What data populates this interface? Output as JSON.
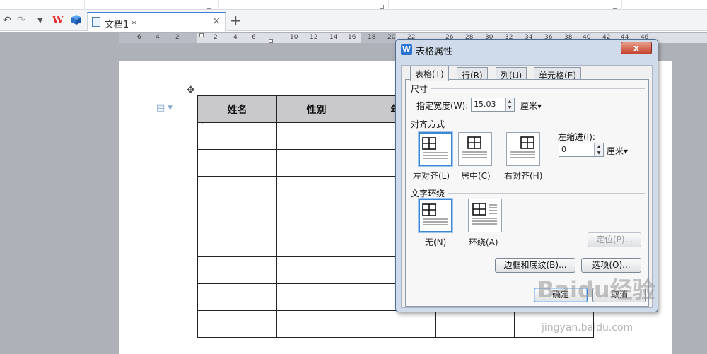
{
  "tabbar": {
    "doc_title": "文档1 *",
    "close_glyph": "×",
    "new_tab_glyph": "+",
    "wps_logo": "W"
  },
  "ruler": {
    "ticks": [
      "6",
      "4",
      "2",
      "2",
      "4",
      "6",
      "10",
      "12",
      "14",
      "16",
      "18",
      "20",
      "22",
      "26",
      "28",
      "30",
      "32",
      "34",
      "36",
      "38",
      "40",
      "42",
      "44",
      "46"
    ]
  },
  "document": {
    "table_headers": [
      "姓名",
      "性别",
      "年"
    ]
  },
  "dialog": {
    "title": "表格属性",
    "close_glyph": "x",
    "tabs": [
      "表格(T)",
      "行(R)",
      "列(U)",
      "单元格(E)"
    ],
    "size_section": "尺寸",
    "width_label": "指定宽度(W):",
    "width_value": "15.03",
    "width_unit": "厘米▾",
    "align_section": "对齐方式",
    "align_left": "左对齐(L)",
    "align_center": "居中(C)",
    "align_right": "右对齐(H)",
    "indent_label": "左缩进(I):",
    "indent_value": "0",
    "indent_unit": "厘米▾",
    "wrap_section": "文字环绕",
    "wrap_none": "无(N)",
    "wrap_around": "环绕(A)",
    "position_button": "定位(P)...",
    "borders_button": "边框和底纹(B)...",
    "options_button": "选项(O)...",
    "ok_button": "确定",
    "cancel_button": "取消"
  },
  "watermark": {
    "brand": "Baidu经验",
    "url": "jingyan.baidu.com"
  },
  "colors": {
    "accent": "#3c7ddc",
    "dialog_bg": "#cfdbea",
    "header_fill": "#c9c9cc",
    "workspace": "#aeb1b8"
  }
}
